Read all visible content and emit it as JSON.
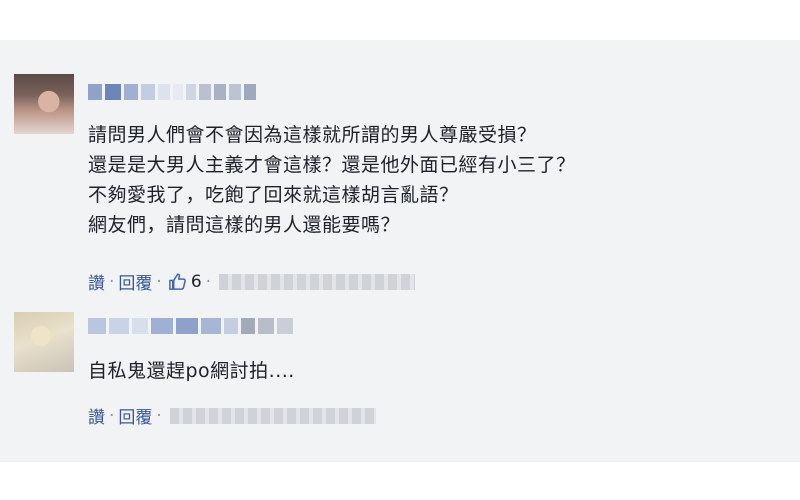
{
  "comments": [
    {
      "author": "",
      "lines": [
        "請問男人們會不會因為這樣就所謂的男人尊嚴受損？",
        "還是是大男人主義才會這樣？還是他外面已經有小三了？",
        "不夠愛我了，吃飽了回來就這樣胡言亂語？",
        "網友們，請問這樣的男人還能要嗎？"
      ],
      "actions": {
        "like": "讚",
        "reply": "回覆",
        "like_count": "6"
      },
      "meta_icon": "thumbs-up-icon"
    },
    {
      "author": "",
      "lines": [
        "自私鬼還趕po網討拍...."
      ],
      "actions": {
        "like": "讚",
        "reply": "回覆"
      }
    }
  ],
  "colors": {
    "panel_bg": "#f2f3f5",
    "link": "#365899",
    "text": "#1d2129",
    "separator": "#90949c"
  }
}
